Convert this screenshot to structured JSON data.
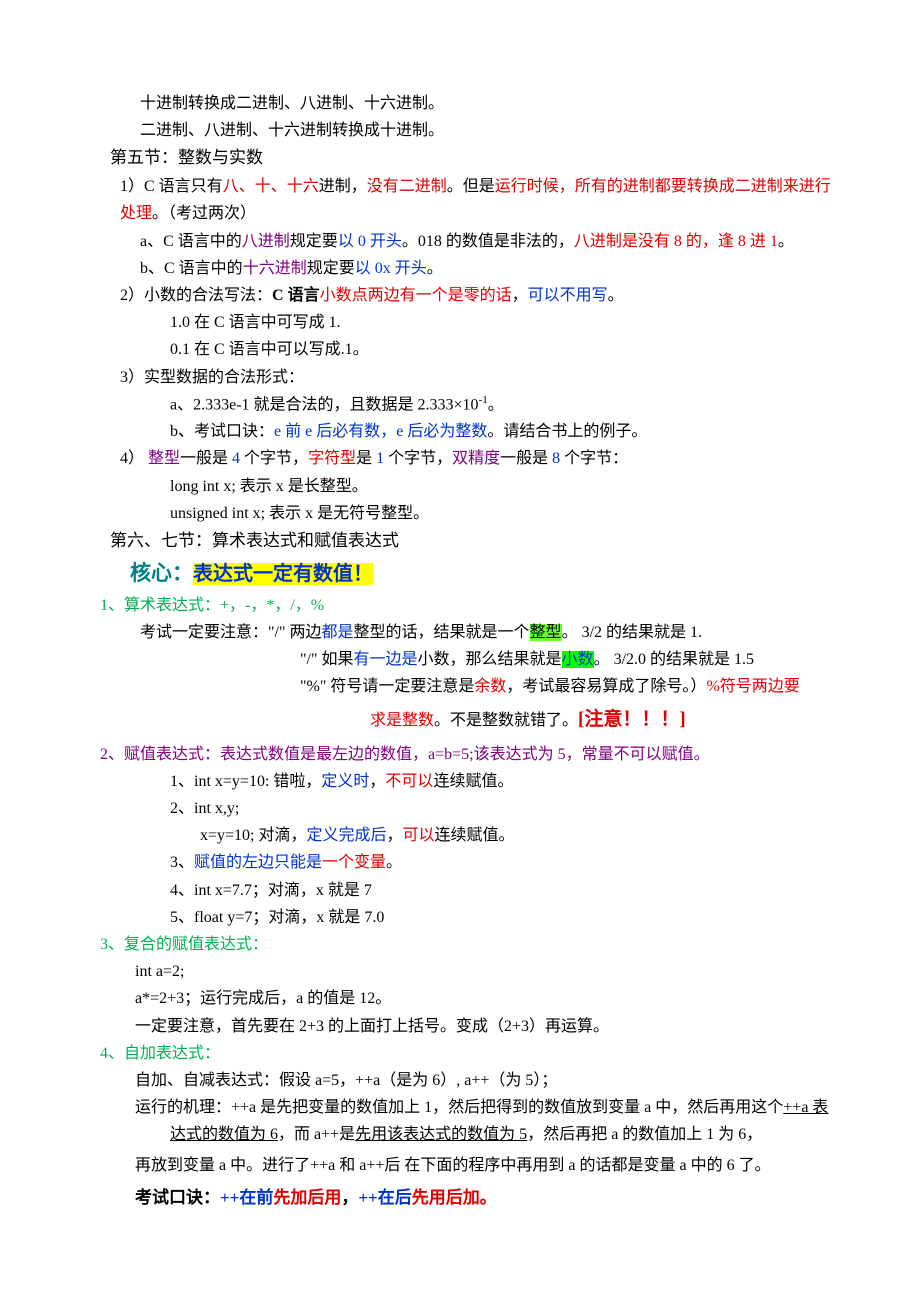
{
  "l1": "十进制转换成二进制、八进制、十六进制。",
  "l2": "二进制、八进制、十六进制转换成十进制。",
  "s5_title": "第五节：整数与实数",
  "s5_1a": "1）C 语言只有",
  "s5_1b": "八、十、十六",
  "s5_1c": "进制，",
  "s5_1d": "没有二进制",
  "s5_1e": "。但是",
  "s5_1f": "运行时候，所有的进制都要转换成二进制来进行处理",
  "s5_1g": "。（考过两次）",
  "s5_a1": "a、C 语言中的",
  "s5_a2": "八进制",
  "s5_a3": "规定要",
  "s5_a4": "以 0 开头",
  "s5_a5": "。018 的数值是非法的，",
  "s5_a6": "八进制是没有 8 的，逢 8 进 1",
  "s5_a7": "。",
  "s5_b1": "b、C 语言中的",
  "s5_b2": "十六进制",
  "s5_b3": "规定要",
  "s5_b4": "以 0x 开头",
  "s5_b5": "。",
  "s5_2a": "2）小数的合法写法：",
  "s5_2b": "C 语言",
  "s5_2c": "小数点两边有一个是零的话",
  "s5_2d": "，",
  "s5_2e": "可以不用写",
  "s5_2f": "。",
  "s5_2l1": "1.0 在 C 语言中可写成 1.",
  "s5_2l2": "0.1 在 C 语言中可以写成.1。",
  "s5_3a": "3）实型数据的合法形式：",
  "s5_3l1a": "a、2.333e-1 就是合法的，且数据是 2.333×10",
  "s5_3l1b": "-1",
  "s5_3l1c": "。",
  "s5_3l2a": "b、考试口诀：",
  "s5_3l2b": "e 前 e 后必有数，e 后必为整数",
  "s5_3l2c": "。请结合书上的例子。",
  "s5_4a": "4）  ",
  "s5_4b": "整型",
  "s5_4c": "一般是 ",
  "s5_4d": "4",
  "s5_4e": " 个字节，",
  "s5_4f": "字符型",
  "s5_4g": "是 ",
  "s5_4h": "1",
  "s5_4i": " 个字节，",
  "s5_4j": "双精度",
  "s5_4k": "一般是 ",
  "s5_4l": "8",
  "s5_4m": " 个字节：",
  "s5_4l1": "long int x; 表示 x 是长整型。",
  "s5_4l2": "unsigned int x; 表示 x 是无符号整型。",
  "s67_title": "第六、七节：算术表达式和赋值表达式",
  "core_a": "核心：",
  "core_b": "表达式一定有数值！",
  "ex1_a": "1、算术表达式：+，-，*，/，%",
  "ex1_l1a": "考试一定要注意：\"/\"  两边",
  "ex1_l1b": "都是",
  "ex1_l1c": "整型的话，结果就是一个",
  "ex1_l1d": "整型",
  "ex1_l1e": "。 3/2 的结果就是 1.",
  "ex1_l2a": "\"/\"  如果",
  "ex1_l2b": "有一边是",
  "ex1_l2c": "小数，那么结果就是",
  "ex1_l2d": "小数",
  "ex1_l2e": "。 3/2.0 的结果就是 1.5",
  "ex1_l3a": "\"%\" 符号请一定要注意是",
  "ex1_l3b": "余数",
  "ex1_l3c": "，考试最容易算成了除号。）",
  "ex1_l3d": "%符号两边要",
  "ex1_l4a": "求是整数",
  "ex1_l4b": "。不是整数就错了。",
  "ex1_l4c": "[注意！！！]",
  "ex2_a": "2、赋值表达式：表达式数值是最左边的数值，a=b=5;该表达式为 5，常量不可以赋值。",
  "ex2_l1a": "1、int x=y=10:  错啦，",
  "ex2_l1b": "定义时",
  "ex2_l1c": "，",
  "ex2_l1d": "不可以",
  "ex2_l1e": "连续赋值。",
  "ex2_l2": "2、int x,y;",
  "ex2_l3a": "x=y=10;    对滴，",
  "ex2_l3b": "定义完成后",
  "ex2_l3c": "，",
  "ex2_l3d": "可以",
  "ex2_l3e": "连续赋值。",
  "ex2_l4a": "3、",
  "ex2_l4b": "赋值的左边只能是",
  "ex2_l4c": "一个变量",
  "ex2_l4d": "。",
  "ex2_l5": "4、int x=7.7；对滴，x 就是 7",
  "ex2_l6": "5、float y=7；对滴，x 就是 7.0",
  "ex3_a": "3、复合的赋值表达式：",
  "ex3_l1": "int a=2;",
  "ex3_l2": "a*=2+3；运行完成后，a 的值是 12。",
  "ex3_l3": "一定要注意，首先要在 2+3 的上面打上括号。变成（2+3）再运算。",
  "ex4_a": "4、自加表达式：",
  "ex4_l1": "自加、自减表达式：假设 a=5，++a（是为 6）,  a++（为 5）；",
  "ex4_l2a": "运行的机理：++a 是先把变量的数值加上 1，然后把得到的数值放到变量 a 中，然后再用这个",
  "ex4_l2b": "++a 表达式的数值为 6",
  "ex4_l2c": "，而 a++是",
  "ex4_l2d": "先用该表达式的数值为 5",
  "ex4_l2e": "，然后再把 a 的数值加上 1 为 6，",
  "ex4_l3": "再放到变量 a 中。进行了++a 和 a++后 在下面的程序中再用到 a 的话都是变量 a 中的 6 了。",
  "ex4_kk_a": "考试口诀：",
  "ex4_kk_b": "++在前",
  "ex4_kk_c": "先加后用",
  "ex4_kk_d": "，",
  "ex4_kk_e": "++在后",
  "ex4_kk_f": "先用后加",
  "ex4_kk_g": "。"
}
